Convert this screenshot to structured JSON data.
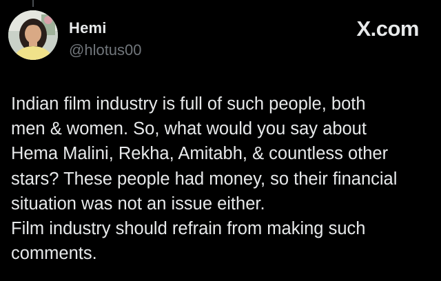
{
  "post": {
    "author": {
      "name": "Hemi",
      "handle": "@hlotus00"
    },
    "brand": "X.com",
    "text": "Indian film industry is full of such people, both\nmen & women. So, what would you say about\nHema Malini, Rekha, Amitabh, & countless other\nstars? These people had money, so their financial\nsituation was not an issue either.\nFilm industry should refrain from making such\ncomments."
  },
  "colors": {
    "background": "#000000",
    "primary_text": "#e7e9ea",
    "secondary_text": "#71767b"
  },
  "icons": {
    "avatar": "profile-photo"
  }
}
